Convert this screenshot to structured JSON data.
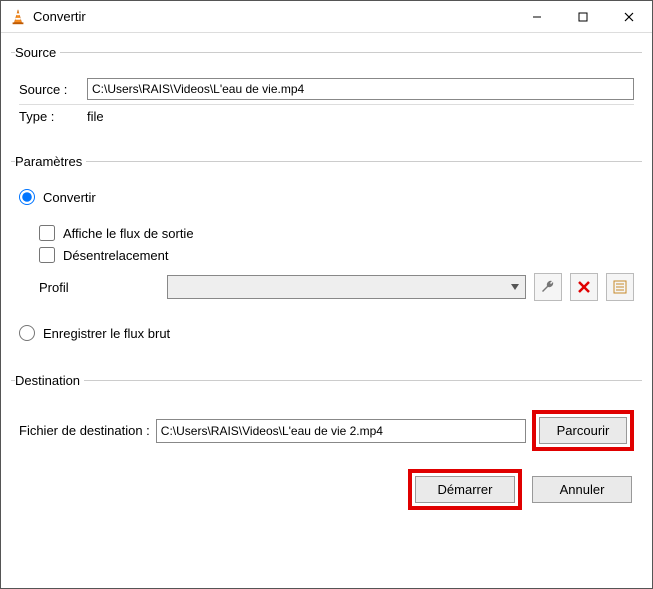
{
  "window": {
    "title": "Convertir"
  },
  "source": {
    "legend": "Source",
    "source_label": "Source :",
    "source_value": "C:\\Users\\RAIS\\Videos\\L'eau de vie.mp4",
    "type_label": "Type :",
    "type_value": "file"
  },
  "params": {
    "legend": "Paramètres",
    "convert_label": "Convertir",
    "show_output_label": "Affiche le flux de sortie",
    "deinterlace_label": "Désentrelacement",
    "profile_label": "Profil",
    "raw_label": "Enregistrer le flux brut"
  },
  "destination": {
    "legend": "Destination",
    "file_label": "Fichier de destination :",
    "file_value": "C:\\Users\\RAIS\\Videos\\L'eau de vie 2.mp4",
    "browse_label": "Parcourir"
  },
  "footer": {
    "start_label": "Démarrer",
    "cancel_label": "Annuler"
  }
}
